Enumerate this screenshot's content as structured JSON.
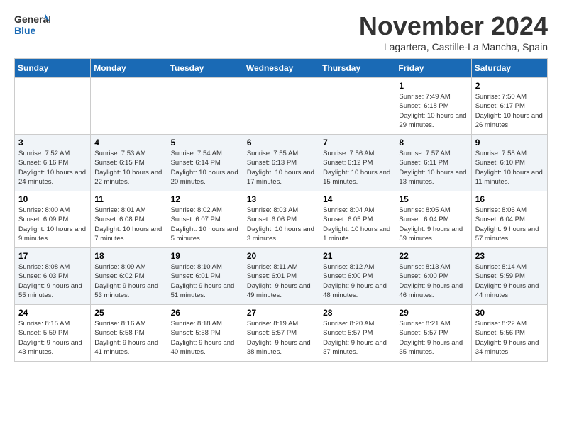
{
  "logo": {
    "line1": "General",
    "line2": "Blue"
  },
  "title": "November 2024",
  "location": "Lagartera, Castille-La Mancha, Spain",
  "days_of_week": [
    "Sunday",
    "Monday",
    "Tuesday",
    "Wednesday",
    "Thursday",
    "Friday",
    "Saturday"
  ],
  "weeks": [
    [
      {
        "day": "",
        "info": ""
      },
      {
        "day": "",
        "info": ""
      },
      {
        "day": "",
        "info": ""
      },
      {
        "day": "",
        "info": ""
      },
      {
        "day": "",
        "info": ""
      },
      {
        "day": "1",
        "info": "Sunrise: 7:49 AM\nSunset: 6:18 PM\nDaylight: 10 hours and 29 minutes."
      },
      {
        "day": "2",
        "info": "Sunrise: 7:50 AM\nSunset: 6:17 PM\nDaylight: 10 hours and 26 minutes."
      }
    ],
    [
      {
        "day": "3",
        "info": "Sunrise: 7:52 AM\nSunset: 6:16 PM\nDaylight: 10 hours and 24 minutes."
      },
      {
        "day": "4",
        "info": "Sunrise: 7:53 AM\nSunset: 6:15 PM\nDaylight: 10 hours and 22 minutes."
      },
      {
        "day": "5",
        "info": "Sunrise: 7:54 AM\nSunset: 6:14 PM\nDaylight: 10 hours and 20 minutes."
      },
      {
        "day": "6",
        "info": "Sunrise: 7:55 AM\nSunset: 6:13 PM\nDaylight: 10 hours and 17 minutes."
      },
      {
        "day": "7",
        "info": "Sunrise: 7:56 AM\nSunset: 6:12 PM\nDaylight: 10 hours and 15 minutes."
      },
      {
        "day": "8",
        "info": "Sunrise: 7:57 AM\nSunset: 6:11 PM\nDaylight: 10 hours and 13 minutes."
      },
      {
        "day": "9",
        "info": "Sunrise: 7:58 AM\nSunset: 6:10 PM\nDaylight: 10 hours and 11 minutes."
      }
    ],
    [
      {
        "day": "10",
        "info": "Sunrise: 8:00 AM\nSunset: 6:09 PM\nDaylight: 10 hours and 9 minutes."
      },
      {
        "day": "11",
        "info": "Sunrise: 8:01 AM\nSunset: 6:08 PM\nDaylight: 10 hours and 7 minutes."
      },
      {
        "day": "12",
        "info": "Sunrise: 8:02 AM\nSunset: 6:07 PM\nDaylight: 10 hours and 5 minutes."
      },
      {
        "day": "13",
        "info": "Sunrise: 8:03 AM\nSunset: 6:06 PM\nDaylight: 10 hours and 3 minutes."
      },
      {
        "day": "14",
        "info": "Sunrise: 8:04 AM\nSunset: 6:05 PM\nDaylight: 10 hours and 1 minute."
      },
      {
        "day": "15",
        "info": "Sunrise: 8:05 AM\nSunset: 6:04 PM\nDaylight: 9 hours and 59 minutes."
      },
      {
        "day": "16",
        "info": "Sunrise: 8:06 AM\nSunset: 6:04 PM\nDaylight: 9 hours and 57 minutes."
      }
    ],
    [
      {
        "day": "17",
        "info": "Sunrise: 8:08 AM\nSunset: 6:03 PM\nDaylight: 9 hours and 55 minutes."
      },
      {
        "day": "18",
        "info": "Sunrise: 8:09 AM\nSunset: 6:02 PM\nDaylight: 9 hours and 53 minutes."
      },
      {
        "day": "19",
        "info": "Sunrise: 8:10 AM\nSunset: 6:01 PM\nDaylight: 9 hours and 51 minutes."
      },
      {
        "day": "20",
        "info": "Sunrise: 8:11 AM\nSunset: 6:01 PM\nDaylight: 9 hours and 49 minutes."
      },
      {
        "day": "21",
        "info": "Sunrise: 8:12 AM\nSunset: 6:00 PM\nDaylight: 9 hours and 48 minutes."
      },
      {
        "day": "22",
        "info": "Sunrise: 8:13 AM\nSunset: 6:00 PM\nDaylight: 9 hours and 46 minutes."
      },
      {
        "day": "23",
        "info": "Sunrise: 8:14 AM\nSunset: 5:59 PM\nDaylight: 9 hours and 44 minutes."
      }
    ],
    [
      {
        "day": "24",
        "info": "Sunrise: 8:15 AM\nSunset: 5:59 PM\nDaylight: 9 hours and 43 minutes."
      },
      {
        "day": "25",
        "info": "Sunrise: 8:16 AM\nSunset: 5:58 PM\nDaylight: 9 hours and 41 minutes."
      },
      {
        "day": "26",
        "info": "Sunrise: 8:18 AM\nSunset: 5:58 PM\nDaylight: 9 hours and 40 minutes."
      },
      {
        "day": "27",
        "info": "Sunrise: 8:19 AM\nSunset: 5:57 PM\nDaylight: 9 hours and 38 minutes."
      },
      {
        "day": "28",
        "info": "Sunrise: 8:20 AM\nSunset: 5:57 PM\nDaylight: 9 hours and 37 minutes."
      },
      {
        "day": "29",
        "info": "Sunrise: 8:21 AM\nSunset: 5:57 PM\nDaylight: 9 hours and 35 minutes."
      },
      {
        "day": "30",
        "info": "Sunrise: 8:22 AM\nSunset: 5:56 PM\nDaylight: 9 hours and 34 minutes."
      }
    ]
  ]
}
